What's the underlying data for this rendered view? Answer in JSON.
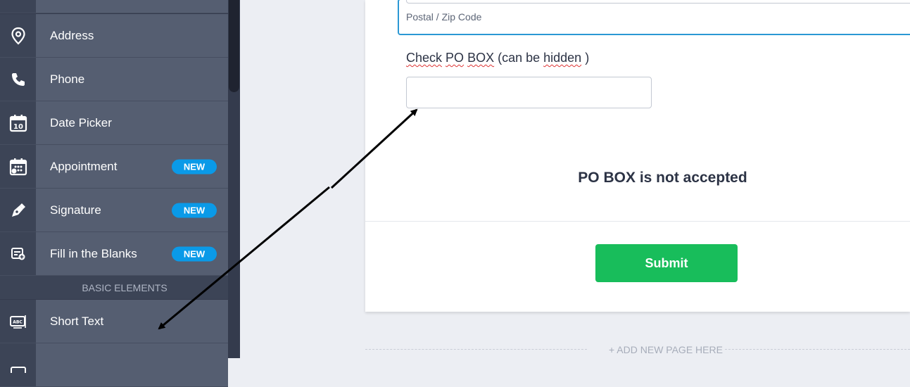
{
  "sidebar": {
    "items": [
      {
        "label": "Address",
        "icon": "map-pin-icon",
        "badge": ""
      },
      {
        "label": "Phone",
        "icon": "phone-icon",
        "badge": ""
      },
      {
        "label": "Date Picker",
        "icon": "calendar-icon",
        "badge": ""
      },
      {
        "label": "Appointment",
        "icon": "appointment-icon",
        "badge": "NEW"
      },
      {
        "label": "Signature",
        "icon": "pen-icon",
        "badge": "NEW"
      },
      {
        "label": "Fill in the Blanks",
        "icon": "fill-blanks-icon",
        "badge": "NEW"
      }
    ],
    "calendar_day": "10",
    "section_header": "BASIC ELEMENTS",
    "basic_items": [
      {
        "label": "Short Text",
        "icon": "short-text-icon",
        "icon_text": "ABC"
      }
    ]
  },
  "form": {
    "zip_sublabel": "Postal / Zip Code",
    "po_label_parts": [
      "Check",
      " ",
      "PO",
      " ",
      "BOX",
      " (can be ",
      "hidden",
      " )"
    ],
    "po_message": "PO BOX is not accepted",
    "submit_label": "Submit",
    "add_page_label": "+ ADD NEW PAGE HERE"
  },
  "colors": {
    "accent": "#0a9ae8",
    "submit": "#18bd5b",
    "sidebar": "#555e71"
  }
}
